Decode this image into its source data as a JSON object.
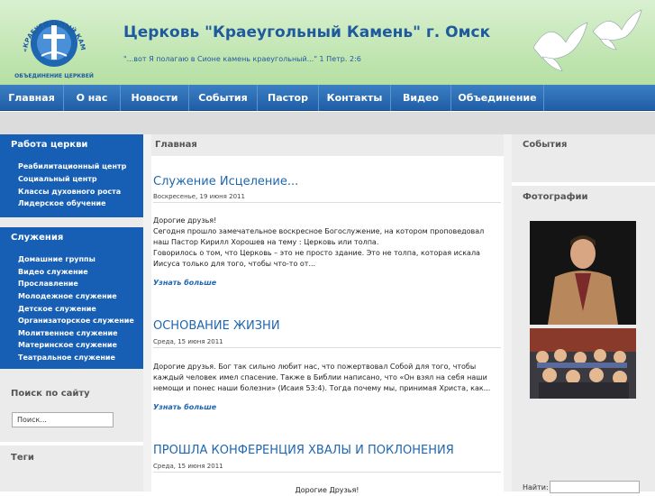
{
  "header": {
    "logo_arc_text": "«КРАЕУГОЛЬНЫЙ КАМЕНЬ»",
    "logo_sub_text": "ОБЪЕДИНЕНИЕ ЦЕРКВЕЙ",
    "title": "Церковь \"Краеугольный Камень\" г. Омск",
    "quote": "\"...вот Я полагаю в Сионе камень краеугольный...\" 1 Петр. 2:6"
  },
  "nav": {
    "items": [
      {
        "label": "Главная"
      },
      {
        "label": "О нас"
      },
      {
        "label": "Новости"
      },
      {
        "label": "События"
      },
      {
        "label": "Пастор"
      },
      {
        "label": "Контакты"
      },
      {
        "label": "Видео"
      },
      {
        "label": "Объединение"
      }
    ]
  },
  "sidebar": {
    "work": {
      "title": "Работа церкви",
      "items": [
        "Реабилитационный центр",
        "Социальный центр",
        "Классы духовного роста",
        "Лидерское обучение"
      ]
    },
    "ministries": {
      "title": "Служения",
      "items": [
        "Домашние группы",
        "Видео служение",
        "Прославление",
        "Молодежное служение",
        "Детское служение",
        "Организаторское служение",
        "Молитвенное служение",
        "Материнское служение",
        "Театральное служение"
      ]
    },
    "search": {
      "title": "Поиск по сайту",
      "value": "Поиск..."
    },
    "tags": {
      "title": "Теги"
    }
  },
  "main": {
    "breadcrumb": "Главная",
    "posts": [
      {
        "title": "Служение Исцеление...",
        "date": "Воскресенье, 19 июня 2011",
        "body": "Дорогие друзья!\nСегодня прошло замечательное воскресное Богослужение, на котором проповедовал наш Пастор Кирилл Хорошев на тему : Церковь или толпа.\nГоворилось о том, что Церковь – это не просто здание. Это не толпа, которая искала Иисуса только для того, чтобы что-то от...",
        "more": "Узнать больше"
      },
      {
        "title": "ОСНОВАНИЕ ЖИЗНИ",
        "date": "Среда, 15 июня 2011",
        "body": "Дорогие друзья. Бог так сильно любит нас, что пожертвовал Собой для того, чтобы каждый человек имел спасение. Также в Библии написано, что «Он взял на себя наши немощи и понес наши болезни» (Исаия 53:4). Тогда почему мы, принимая Христа, как...",
        "more": "Узнать больше"
      },
      {
        "title": "ПРОШЛА КОНФЕРЕНЦИЯ ХВАЛЫ И ПОКЛОНЕНИЯ",
        "date": "Среда, 15 июня 2011",
        "body": "Дорогие Друзья!"
      }
    ]
  },
  "right": {
    "events_title": "События",
    "photos_title": "Фотографии",
    "find_label": "Найти:"
  },
  "colors": {
    "nav_blue": "#1f5ea8",
    "sidebar_blue": "#175fb4",
    "link_blue": "#1f66b0",
    "header_green": "#c3e6b4"
  }
}
